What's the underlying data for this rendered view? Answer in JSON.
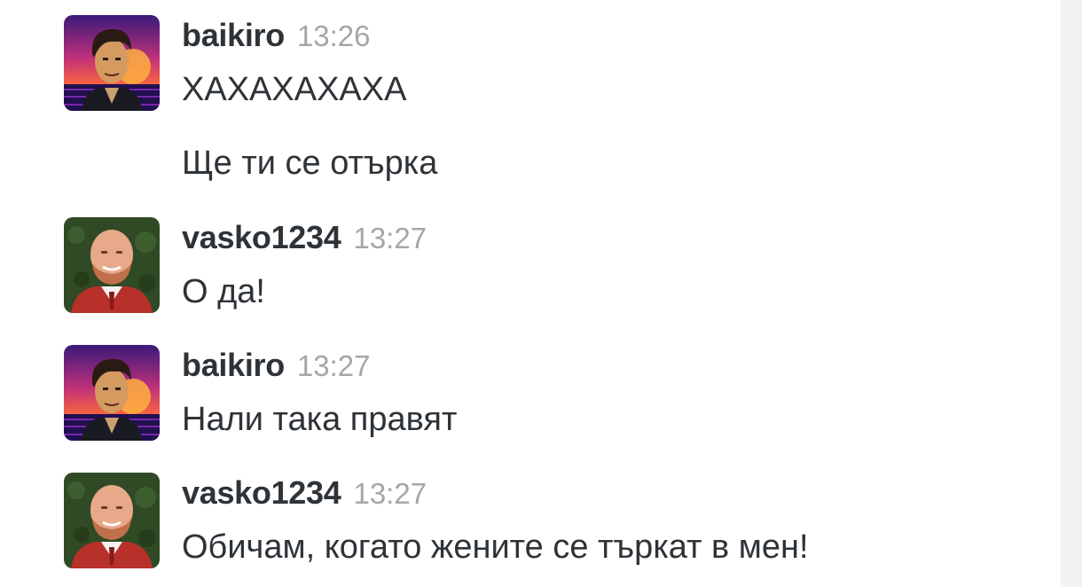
{
  "messages": [
    {
      "username": "baikiro",
      "time": "13:26",
      "text": "ХАХАХАХАХА",
      "avatar": "synthwave-man-avatar"
    },
    {
      "username": "vasko1234",
      "time": "13:27",
      "text": "О да!",
      "avatar": "bald-bearded-man-avatar"
    },
    {
      "username": "baikiro",
      "time": "13:27",
      "text": "Нали така правят",
      "avatar": "synthwave-man-avatar"
    },
    {
      "username": "vasko1234",
      "time": "13:27",
      "text": "Обичам, когато жените се търкат в мен!",
      "avatar": "bald-bearded-man-avatar"
    }
  ],
  "continuation": {
    "text": "Ще ти се отърка"
  },
  "colors": {
    "username": "#2e3338",
    "timestamp": "#a3a6aa",
    "text": "#2e3338",
    "scrollbar_track": "#f2f2f3"
  }
}
